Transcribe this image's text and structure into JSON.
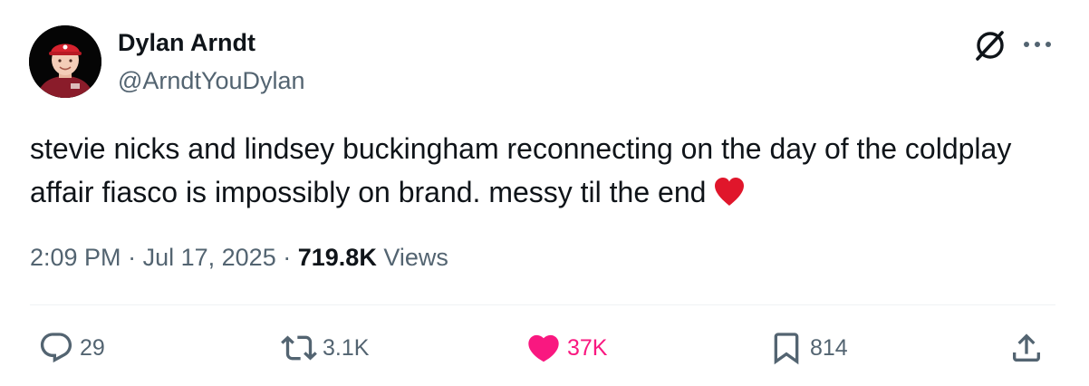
{
  "author": {
    "display_name": "Dylan Arndt",
    "handle": "@ArndtYouDylan"
  },
  "tweet": {
    "text": "stevie nicks and lindsey buckingham reconnecting on the day of the coldplay affair fiasco is impossibly on brand. messy til the end",
    "emoji": "red-heart-emoji"
  },
  "meta": {
    "time": "2:09 PM",
    "separator": "·",
    "date": "Jul 17, 2025",
    "views_count": "719.8K",
    "views_label": "Views"
  },
  "actions": {
    "replies": "29",
    "reposts": "3.1K",
    "likes": "37K",
    "bookmarks": "814"
  },
  "icons": {
    "reply": "reply-icon",
    "repost": "repost-icon",
    "like": "heart-icon",
    "bookmark": "bookmark-icon",
    "share": "share-icon",
    "grok": "grok-icon",
    "more": "more-icon"
  },
  "colors": {
    "text": "#0f1419",
    "secondary": "#536471",
    "like": "#f91880",
    "heart_emoji": "#e0162b",
    "divider": "#eff3f4"
  }
}
